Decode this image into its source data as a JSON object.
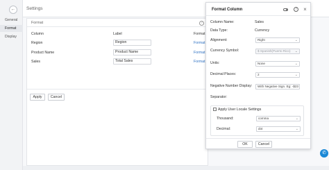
{
  "rail": {
    "back_icon": "←",
    "items": [
      {
        "label": "General"
      },
      {
        "label": "Format"
      },
      {
        "label": "Display"
      }
    ]
  },
  "settings": {
    "title": "Settings"
  },
  "format_card": {
    "title": "Format",
    "help_icon": "?",
    "columns": {
      "column": "Column",
      "label": "Label",
      "format": "Format"
    },
    "rows": [
      {
        "column": "Region",
        "label": "Region",
        "format": "Format"
      },
      {
        "column": "Product Name",
        "label": "Product Name",
        "format": "Format"
      },
      {
        "column": "Sales",
        "label": "Total Sales",
        "format": "Format"
      }
    ],
    "apply": "Apply",
    "cancel": "Cancel"
  },
  "dialog": {
    "title": "Format Column",
    "help_icon": "?",
    "close_icon": "×",
    "fields": {
      "column_name_label": "Column Name:",
      "column_name_value": "Sales",
      "data_type_label": "Data Type:",
      "data_type_value": "Currency",
      "alignment_label": "Alignment:",
      "alignment_value": "Right",
      "currency_symbol_label": "Currency Symbol:",
      "currency_symbol_value": "$ Spanish(Puerto Rico)",
      "units_label": "Units:",
      "units_value": "None",
      "decimal_places_label": "Decimal Places:",
      "decimal_places_value": "2",
      "negative_label": "Negative Number Display:",
      "negative_value": "With Negative Sign. Eg: -$23",
      "separator_label": "Separator:",
      "apply_locale_label": "Apply User Locale Settings",
      "thousand_label": "Thousand:",
      "thousand_value": "comma",
      "decimal_label": "Decimal:",
      "decimal_value": "dot"
    },
    "ok": "OK",
    "cancel": "Cancel"
  },
  "chat_icon": "✆",
  "colors": {
    "link": "#2b6fc2",
    "chat": "#1a88d6"
  }
}
